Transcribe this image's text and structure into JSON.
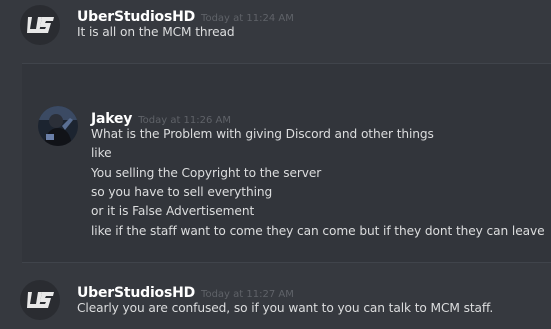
{
  "messages": [
    {
      "username": "UberStudiosHD",
      "timestamp": "Today at 11:24 AM",
      "lines": [
        "It is all on the MCM thread"
      ],
      "avatar": "uberstudios-logo"
    },
    {
      "username": "Jakey",
      "timestamp": "Today at 11:26 AM",
      "lines": [
        "What is the Problem with giving Discord and other things",
        "like",
        "You selling the Copyright to the server",
        "so you have to sell everything",
        "or it is False Advertisement",
        "like if the staff want to come they can come but if they dont they can leave"
      ],
      "avatar": "jakey-photo"
    },
    {
      "username": "UberStudiosHD",
      "timestamp": "Today at 11:27 AM",
      "lines": [
        "Clearly you are confused, so if you want to you can talk to MCM staff."
      ],
      "avatar": "uberstudios-logo"
    }
  ],
  "colors": {
    "background": "#36393f",
    "username": "#ffffff",
    "timestamp": "#5f6268",
    "message_text": "#dcddde",
    "divider": "#40444b"
  }
}
